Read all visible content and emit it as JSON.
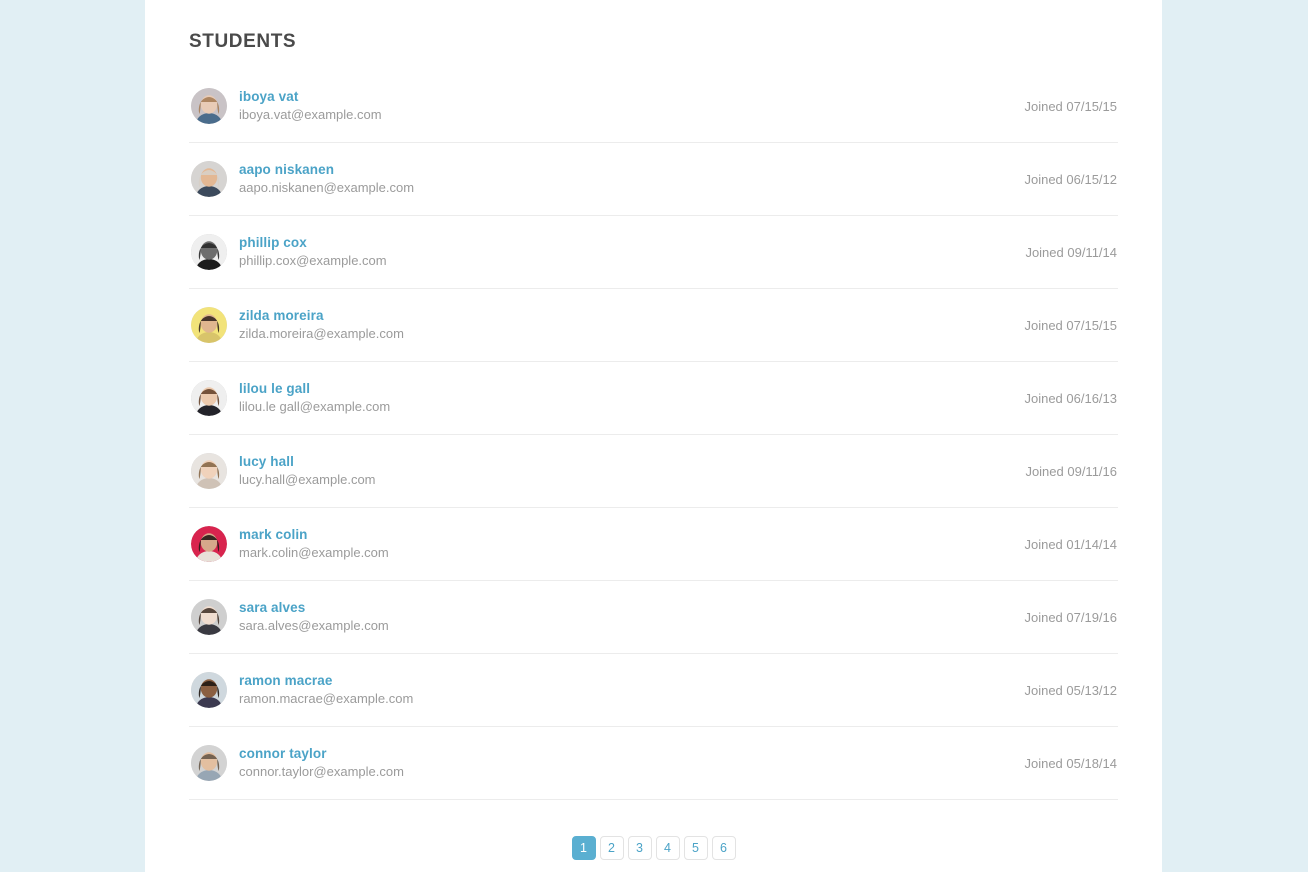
{
  "page": {
    "background_color": "#e1eff4",
    "card_color": "#ffffff",
    "accent_color": "#4ba3c7",
    "active_page_color": "#5aafd1",
    "title": "STUDENTS"
  },
  "students": [
    {
      "name": "iboya vat",
      "email": "iboya.vat@example.com",
      "joined": "Joined 07/15/15",
      "avatar": {
        "name": "avatar-iboya-vat",
        "bg": "#c9c3c6",
        "skin": "#e8cbb6",
        "hair": "#a8805a",
        "cloth": "#4a6c8c"
      }
    },
    {
      "name": "aapo niskanen",
      "email": "aapo.niskanen@example.com",
      "joined": "Joined 06/15/12",
      "avatar": {
        "name": "avatar-aapo-niskanen",
        "bg": "#d6d4d2",
        "skin": "#e3b894",
        "hair": "#d8cfc6",
        "cloth": "#3c4a5c"
      }
    },
    {
      "name": "phillip cox",
      "email": "phillip.cox@example.com",
      "joined": "Joined 09/11/14",
      "avatar": {
        "name": "avatar-phillip-cox",
        "bg": "#efefef",
        "skin": "#6e6e6e",
        "hair": "#2a2a2a",
        "cloth": "#1c1c1c"
      }
    },
    {
      "name": "zilda moreira",
      "email": "zilda.moreira@example.com",
      "joined": "Joined 07/15/15",
      "avatar": {
        "name": "avatar-zilda-moreira",
        "bg": "#f2e37a",
        "skin": "#e0b68f",
        "hair": "#3a2a22",
        "cloth": "#d8c46a"
      }
    },
    {
      "name": "lilou le gall",
      "email": "lilou.le gall@example.com",
      "joined": "Joined 06/16/13",
      "avatar": {
        "name": "avatar-lilou-le-gall",
        "bg": "#efefef",
        "skin": "#eccaae",
        "hair": "#6a4830",
        "cloth": "#23232a"
      }
    },
    {
      "name": "lucy hall",
      "email": "lucy.hall@example.com",
      "joined": "Joined 09/11/16",
      "avatar": {
        "name": "avatar-lucy-hall",
        "bg": "#e8e4e0",
        "skin": "#f0d2bb",
        "hair": "#8a6a4a",
        "cloth": "#cfc2b6"
      }
    },
    {
      "name": "mark colin",
      "email": "mark.colin@example.com",
      "joined": "Joined 01/14/14",
      "avatar": {
        "name": "avatar-mark-colin",
        "bg": "#d8244e",
        "skin": "#d6a88a",
        "hair": "#2a1c18",
        "cloth": "#e8e0d8"
      }
    },
    {
      "name": "sara alves",
      "email": "sara.alves@example.com",
      "joined": "Joined 07/19/16",
      "avatar": {
        "name": "avatar-sara-alves",
        "bg": "#cfcfcf",
        "skin": "#f0ddd0",
        "hair": "#4a3a30",
        "cloth": "#3a3a42"
      }
    },
    {
      "name": "ramon macrae",
      "email": "ramon.macrae@example.com",
      "joined": "Joined 05/13/12",
      "avatar": {
        "name": "avatar-ramon-macrae",
        "bg": "#cfd8de",
        "skin": "#8a5f42",
        "hair": "#231a14",
        "cloth": "#3c3a50"
      }
    },
    {
      "name": "connor taylor",
      "email": "connor.taylor@example.com",
      "joined": "Joined 05/18/14",
      "avatar": {
        "name": "avatar-connor-taylor",
        "bg": "#d3d3d3",
        "skin": "#e3bfa0",
        "hair": "#6a5a4a",
        "cloth": "#97a6b4"
      }
    }
  ],
  "pagination": {
    "pages": [
      "1",
      "2",
      "3",
      "4",
      "5",
      "6"
    ],
    "active_index": 0
  }
}
